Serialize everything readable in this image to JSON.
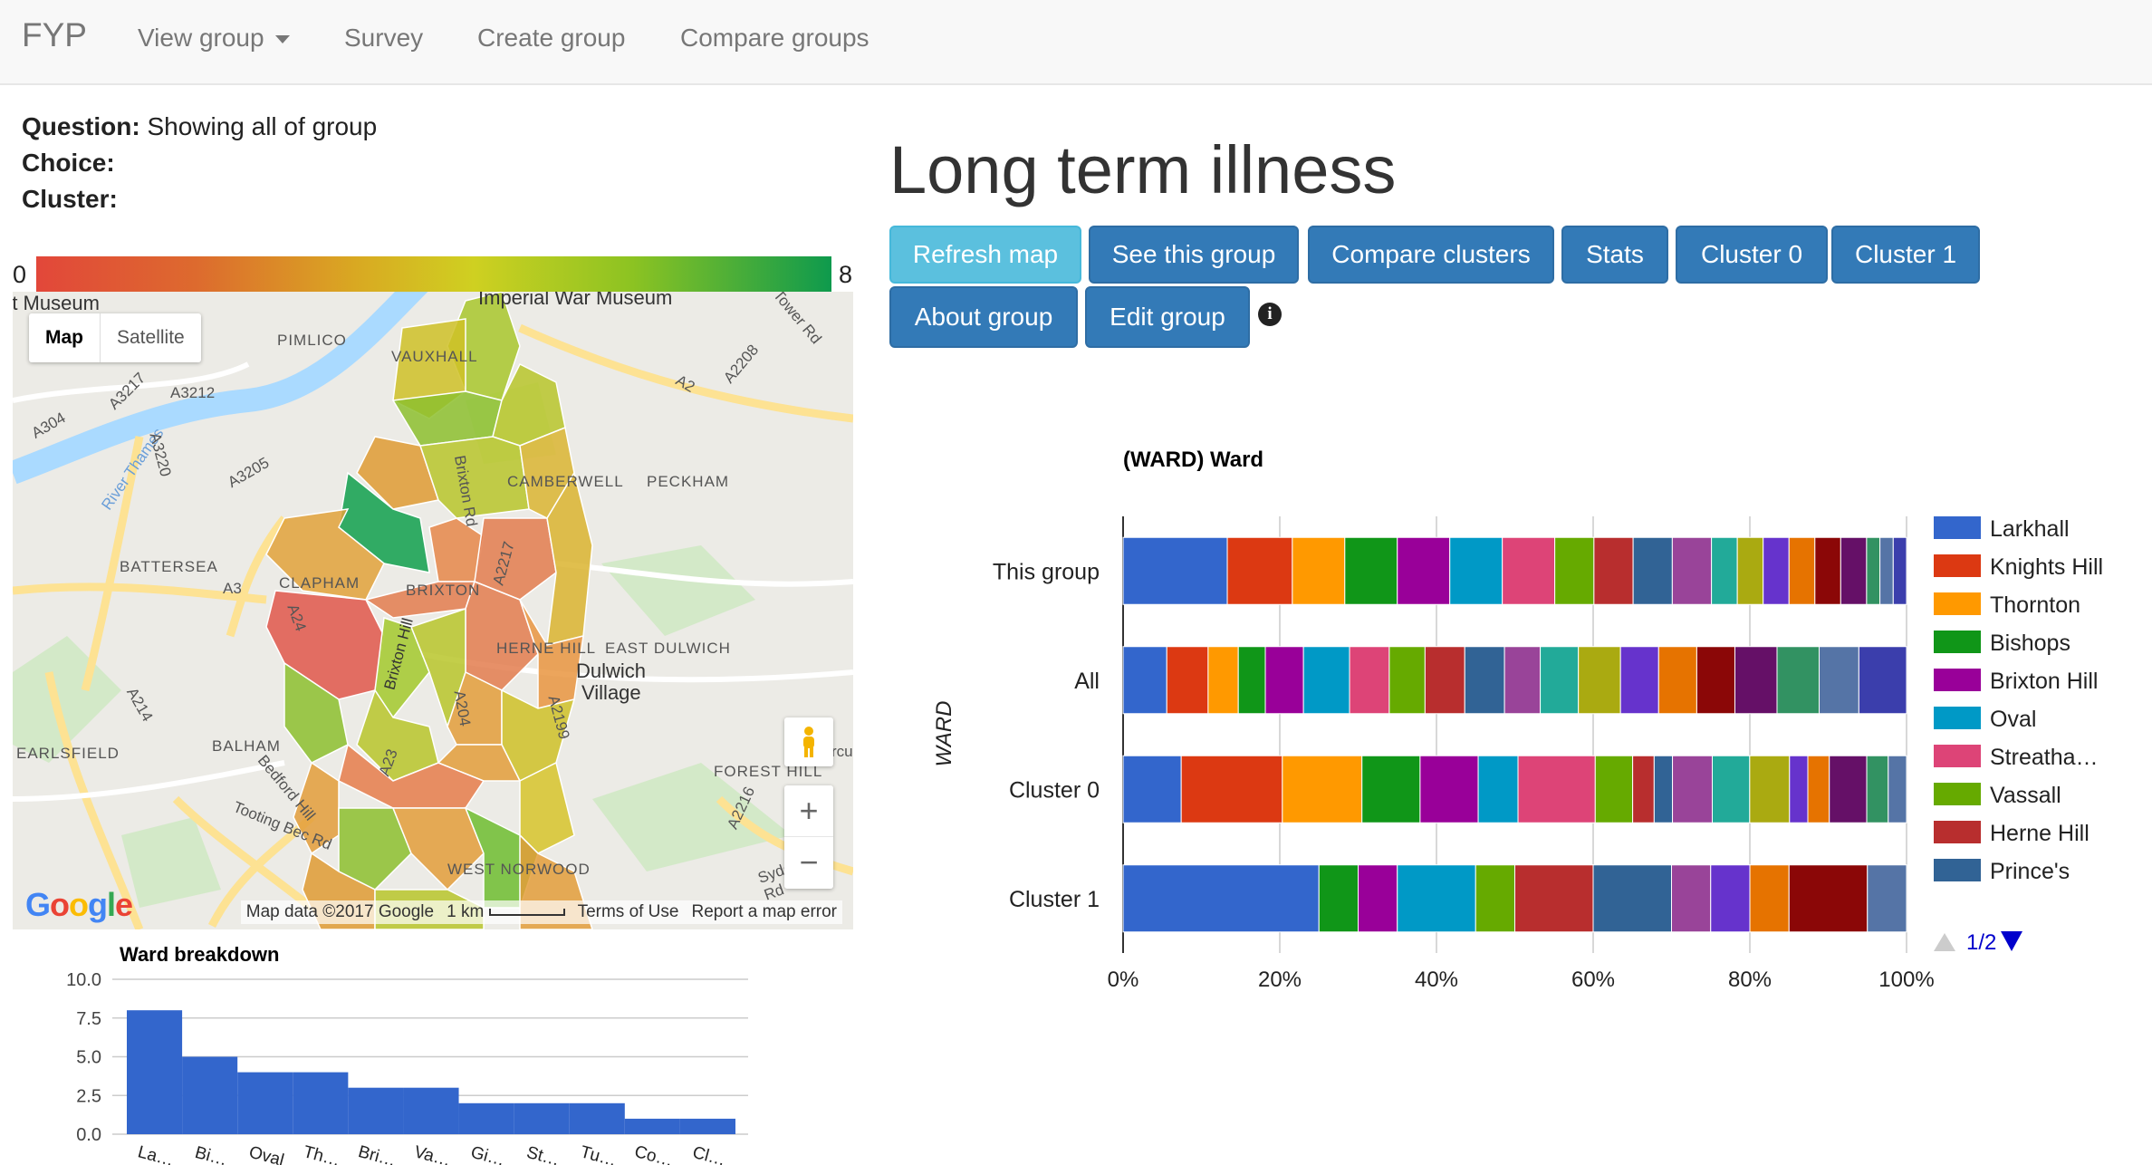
{
  "navbar": {
    "brand": "FYP",
    "items": [
      {
        "label": "View group",
        "dropdown": true
      },
      {
        "label": "Survey"
      },
      {
        "label": "Create group"
      },
      {
        "label": "Compare groups"
      }
    ]
  },
  "info": {
    "question_label": "Question:",
    "question_value": "Showing all of group",
    "choice_label": "Choice:",
    "choice_value": "",
    "cluster_label": "Cluster:",
    "cluster_value": ""
  },
  "title": "Long term illness",
  "buttons": {
    "refresh": "Refresh map",
    "see_group": "See this group",
    "compare_clusters": "Compare clusters",
    "stats": "Stats",
    "cluster0": "Cluster 0",
    "cluster1": "Cluster 1",
    "about": "About group",
    "edit": "Edit group"
  },
  "info_icon": "info-icon",
  "color_scale": {
    "min": "0",
    "max": "8",
    "low_color": "#e2473a",
    "high_color": "#0e9a4d"
  },
  "map": {
    "toggle_map": "Map",
    "toggle_satellite": "Satellite",
    "zoom_in": "+",
    "zoom_out": "−",
    "google": "Google",
    "attribution": "Map data ©2017 Google",
    "scale": "1 km",
    "terms": "Terms of Use",
    "report": "Report a map error",
    "labels": [
      "rt Museum",
      "Imperial War Museum",
      "PIMLICO",
      "VAUXHALL",
      "CAMBERWELL",
      "PECKHAM",
      "BATTERSEA",
      "CLAPHAM",
      "BRIXTON",
      "HERNE HILL",
      "EAST DULWICH",
      "Dulwich",
      "Village",
      "BALHAM",
      "EARLSFIELD",
      "FOREST HILL",
      "WEST NORWOOD",
      "Tooting Bec Rd",
      "River Thames",
      "A3212",
      "A3205",
      "A3220",
      "A3217",
      "A304",
      "A3",
      "A24",
      "A214",
      "A2208",
      "A2",
      "A2217",
      "A204",
      "A2199",
      "A23",
      "A2216",
      "Brixton Rd",
      "Brixton Hill",
      "Sydenham Rd",
      "Bedford Hill",
      "Tower Rd",
      "rcu"
    ]
  },
  "ward_chart": {
    "title": "Ward breakdown",
    "chart_data": {
      "type": "bar",
      "title": "Ward breakdown",
      "yticks": [
        "10.0",
        "7.5",
        "5.0",
        "2.5",
        "0.0"
      ],
      "ylim": [
        0,
        10
      ],
      "tick_labels": [
        "La…",
        "Bi…",
        "Oval",
        "Th…",
        "Bri…",
        "Va…",
        "Gi…",
        "St…",
        "Tu…",
        "Co…",
        "Cl…"
      ],
      "values": [
        8,
        5,
        4,
        4,
        3,
        3,
        2,
        2,
        2,
        1,
        1
      ]
    }
  },
  "stacked_chart": {
    "title": "(WARD) Ward",
    "yaxis_label": "WARD",
    "pager": "1/2",
    "chart_data": {
      "type": "bar",
      "orientation": "horizontal-stacked-percent",
      "categories": [
        "This group",
        "All",
        "Cluster 0",
        "Cluster 1"
      ],
      "x_ticks": [
        "0%",
        "20%",
        "40%",
        "60%",
        "80%",
        "100%"
      ],
      "legend": [
        {
          "name": "Larkhall",
          "color": "#3366cc"
        },
        {
          "name": "Knights Hill",
          "color": "#dc3912"
        },
        {
          "name": "Thornton",
          "color": "#ff9900"
        },
        {
          "name": "Bishops",
          "color": "#109618"
        },
        {
          "name": "Brixton Hill",
          "color": "#990099"
        },
        {
          "name": "Oval",
          "color": "#0099c6"
        },
        {
          "name": "Streatha…",
          "color": "#dd4477"
        },
        {
          "name": "Vassall",
          "color": "#66aa00"
        },
        {
          "name": "Herne Hill",
          "color": "#b82e2e"
        },
        {
          "name": "Prince's",
          "color": "#316395"
        }
      ],
      "palette": [
        "#3366cc",
        "#dc3912",
        "#ff9900",
        "#109618",
        "#990099",
        "#0099c6",
        "#dd4477",
        "#66aa00",
        "#b82e2e",
        "#316395",
        "#994499",
        "#22aa99",
        "#aaaa11",
        "#6633cc",
        "#e67300",
        "#8b0707",
        "#651067",
        "#329262",
        "#5574a6",
        "#3b3eac"
      ],
      "series_percent": {
        "This group": [
          13.3,
          8.3,
          6.7,
          6.7,
          6.7,
          6.7,
          6.7,
          5.0,
          5.0,
          5.0,
          5.0,
          3.3,
          3.3,
          3.3,
          3.3,
          3.3,
          3.3,
          1.7,
          1.7,
          1.7
        ],
        "All": [
          5.5,
          5.2,
          3.8,
          3.4,
          4.8,
          5.8,
          5.0,
          4.5,
          5.0,
          5.0,
          4.5,
          4.8,
          5.3,
          4.8,
          4.8,
          4.8,
          5.3,
          5.3,
          5.0,
          6.0
        ],
        "Cluster 0": [
          7.3,
          12.7,
          10.0,
          7.3,
          7.3,
          5.0,
          9.7,
          4.7,
          2.7,
          2.3,
          5.0,
          4.7,
          5.0,
          2.3,
          2.7,
          0,
          4.7,
          2.7,
          2.3,
          0
        ],
        "Cluster 1": [
          25.0,
          0,
          0,
          5.0,
          5.0,
          10.0,
          0,
          5.0,
          10.0,
          10.0,
          5.0,
          0,
          0,
          5.0,
          5.0,
          10.0,
          0,
          0,
          5.0,
          0
        ]
      }
    }
  }
}
